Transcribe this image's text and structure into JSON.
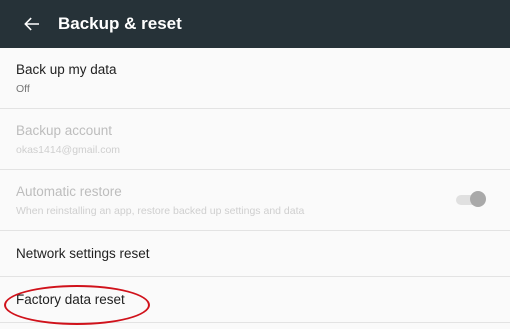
{
  "appbar": {
    "title": "Backup & reset",
    "back_icon": "arrow-back-icon",
    "background": "#263238"
  },
  "items": [
    {
      "title": "Back up my data",
      "summary": "Off",
      "enabled": true
    },
    {
      "title": "Backup account",
      "summary": "okas1414@gmail.com",
      "enabled": false
    },
    {
      "title": "Automatic restore",
      "summary": "When reinstalling an app, restore backed up settings and data",
      "enabled": false,
      "toggle": "on"
    },
    {
      "title": "Network settings reset",
      "enabled": true
    },
    {
      "title": "Factory data reset",
      "enabled": true
    }
  ],
  "annotation": {
    "highlight_color": "#d0121b",
    "target": "Factory data reset"
  }
}
